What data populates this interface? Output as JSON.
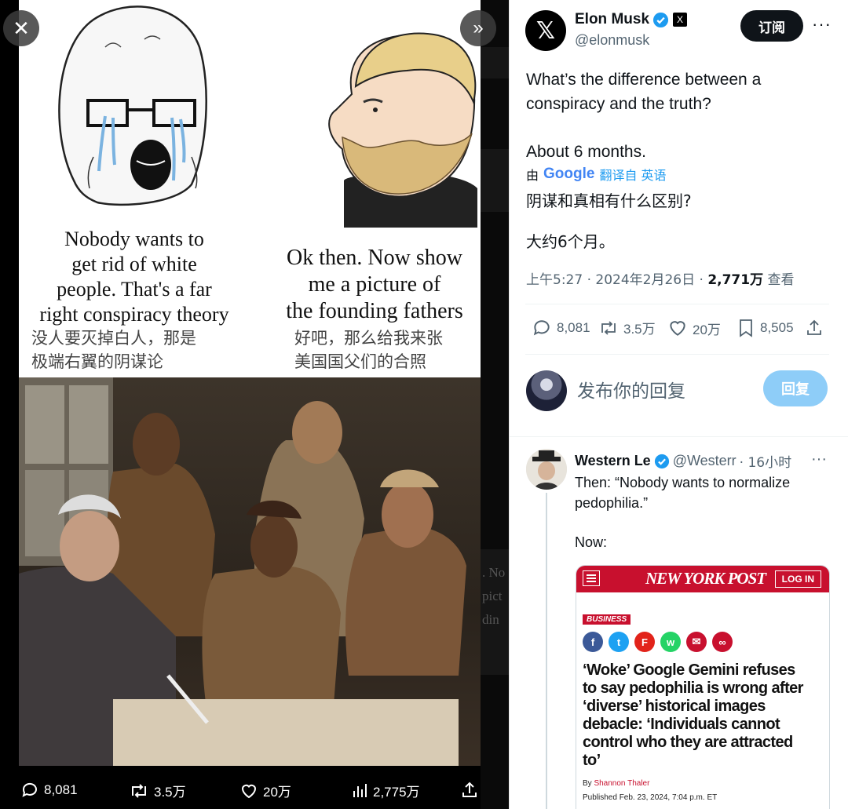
{
  "viewer": {
    "close_icon": "close-icon",
    "next_icon": "double-chevron-right-icon",
    "meme": {
      "left_caption_lines": [
        "Nobody wants to",
        "get rid of white",
        "people. That's a far",
        "right conspiracy theory"
      ],
      "left_caption_zh_lines": [
        "没人要灭掉白人，那是",
        "极端右翼的阴谋论"
      ],
      "right_caption_lines": [
        "Ok then. Now show",
        "me a picture of",
        "the founding fathers"
      ],
      "right_caption_zh_lines": [
        "好吧，那么给我来张",
        "美国国父们的合照"
      ]
    },
    "actions": {
      "replies": "8,081",
      "reposts": "3.5万",
      "likes": "20万",
      "views": "2,775万"
    }
  },
  "tweet": {
    "author_name": "Elon Musk",
    "author_handle": "@elonmusk",
    "subscribe_label": "订阅",
    "text_line1": "What’s the difference between a",
    "text_line2": "conspiracy and the truth?",
    "text_line3": "About 6 months.",
    "translated_by_prefix": "由",
    "translator_logo": "Google",
    "translated_from": "翻译自 英语",
    "translation_line1": "阴谋和真相有什么区别?",
    "translation_line2": "大约6个月。",
    "time": "上午5:27 · 2024年2月26日 ·",
    "views_count": "2,771万",
    "views_label": "查看",
    "stats": {
      "replies": "8,081",
      "reposts": "3.5万",
      "likes": "20万",
      "bookmarks": "8,505"
    }
  },
  "composer": {
    "placeholder": "发布你的回复",
    "reply_button": "回复"
  },
  "reply": {
    "author_name": "Western Le",
    "author_handle": "@Westerr",
    "time": "· 16小时",
    "line1": "Then: “Nobody wants to normalize",
    "line2": "pedophilia.”",
    "line3": "Now:",
    "card": {
      "masthead": "NEW YORK POST",
      "login_label": "LOG IN",
      "section": "BUSINESS",
      "headline_lines": [
        "‘Woke’ Google Gemini refuses",
        "to say pedophilia is wrong after",
        "‘diverse’ historical images",
        "debacle: ‘Individuals cannot",
        "control who they are attracted",
        "to’"
      ],
      "byline_prefix": "By",
      "byline_author": "Shannon Thaler",
      "published": "Published Feb. 23, 2024, 7:04 p.m. ET"
    }
  },
  "colors": {
    "verified_blue": "#1d9bf0",
    "text_primary": "#0f1419",
    "text_secondary": "#536471",
    "nyp_red": "#c8102e",
    "reply_button_disabled": "#8ecdf8"
  }
}
